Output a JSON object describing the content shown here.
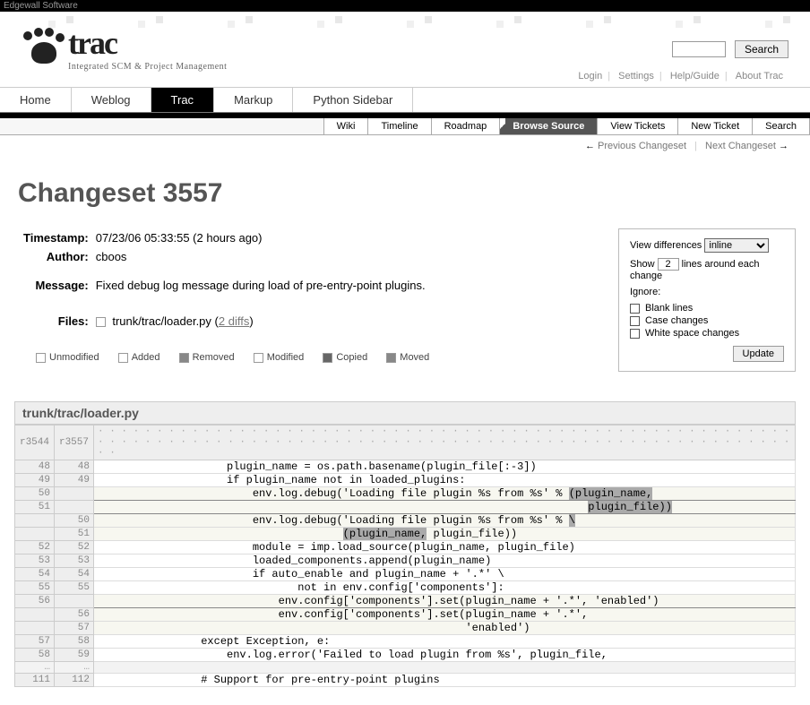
{
  "topbar": {
    "vendor": "Edgewall Software"
  },
  "logo": {
    "main": "trac",
    "sub": "Integrated SCM & Project Management"
  },
  "search": {
    "button": "Search"
  },
  "metanav": {
    "login": "Login",
    "settings": "Settings",
    "help": "Help/Guide",
    "about": "About Trac"
  },
  "mainnav": {
    "home": "Home",
    "weblog": "Weblog",
    "trac": "Trac",
    "markup": "Markup",
    "python": "Python Sidebar"
  },
  "ctxnav": {
    "wiki": "Wiki",
    "timeline": "Timeline",
    "roadmap": "Roadmap",
    "browse": "Browse Source",
    "viewtickets": "View Tickets",
    "newticket": "New Ticket",
    "search": "Search"
  },
  "pagenav": {
    "prev": "Previous Changeset",
    "next": "Next Changeset"
  },
  "title": "Changeset 3557",
  "info": {
    "timestamp_label": "Timestamp:",
    "timestamp_value": "07/23/06 05:33:55 (2 hours ago)",
    "author_label": "Author:",
    "author_value": "cboos",
    "message_label": "Message:",
    "message_value": "Fixed debug log message during load of pre-entry-point plugins.",
    "files_label": "Files:",
    "file_path": "trunk/trac/loader.py",
    "file_diffs": "2 diffs"
  },
  "legend": {
    "unmodified": "Unmodified",
    "added": "Added",
    "removed": "Removed",
    "modified": "Modified",
    "copied": "Copied",
    "moved": "Moved"
  },
  "options": {
    "viewdiff_label": "View differences",
    "viewdiff_value": "inline",
    "show_label": "Show",
    "show_value": "2",
    "show_suffix": "lines around each change",
    "ignore_label": "Ignore:",
    "blank": "Blank lines",
    "case": "Case changes",
    "ws": "White space changes",
    "update": "Update"
  },
  "diff": {
    "file": "trunk/trac/loader.py",
    "col_old": "r3544",
    "col_new": "r3557",
    "rows": [
      {
        "o": "48",
        "n": "48",
        "t": "ctx",
        "c": "                    plugin_name = os.path.basename(plugin_file[:-3])"
      },
      {
        "o": "49",
        "n": "49",
        "t": "ctx",
        "c": "                    if plugin_name not in loaded_plugins:"
      },
      {
        "o": "50",
        "n": "",
        "t": "rem",
        "c": "                        env.log.debug('Loading file plugin %s from %s' % ",
        "hl": "(plugin_name,"
      },
      {
        "o": "51",
        "n": "",
        "t": "rem",
        "c": "                                                                            ",
        "hl": "plugin_file))"
      },
      {
        "o": "",
        "n": "50",
        "t": "add",
        "c": "                        env.log.debug('Loading file plugin %s from %s' % ",
        "hl": "\\"
      },
      {
        "o": "",
        "n": "51",
        "t": "add",
        "c": "                                      ",
        "hl": "(plugin_name,",
        "c2": " plugin_file))"
      },
      {
        "o": "52",
        "n": "52",
        "t": "ctx",
        "c": "                        module = imp.load_source(plugin_name, plugin_file)"
      },
      {
        "o": "53",
        "n": "53",
        "t": "ctx",
        "c": "                        loaded_components.append(plugin_name)"
      },
      {
        "o": "54",
        "n": "54",
        "t": "ctx",
        "c": "                        if auto_enable and plugin_name + '.*' \\"
      },
      {
        "o": "55",
        "n": "55",
        "t": "ctx",
        "c": "                               not in env.config['components']:"
      },
      {
        "o": "56",
        "n": "",
        "t": "rem",
        "c": "                            env.config['components'].set(plugin_name + '.*', 'enabled')"
      },
      {
        "o": "",
        "n": "56",
        "t": "add",
        "c": "                            env.config['components'].set(plugin_name + '.*',"
      },
      {
        "o": "",
        "n": "57",
        "t": "add",
        "c": "                                                         'enabled')"
      },
      {
        "o": "57",
        "n": "58",
        "t": "ctx",
        "c": "                except Exception, e:"
      },
      {
        "o": "58",
        "n": "59",
        "t": "ctx",
        "c": "                    env.log.error('Failed to load plugin from %s', plugin_file,"
      },
      {
        "o": "…",
        "n": "…",
        "t": "skip",
        "c": ""
      },
      {
        "o": "111",
        "n": "112",
        "t": "ctx",
        "c": "                # Support for pre-entry-point plugins"
      }
    ]
  }
}
